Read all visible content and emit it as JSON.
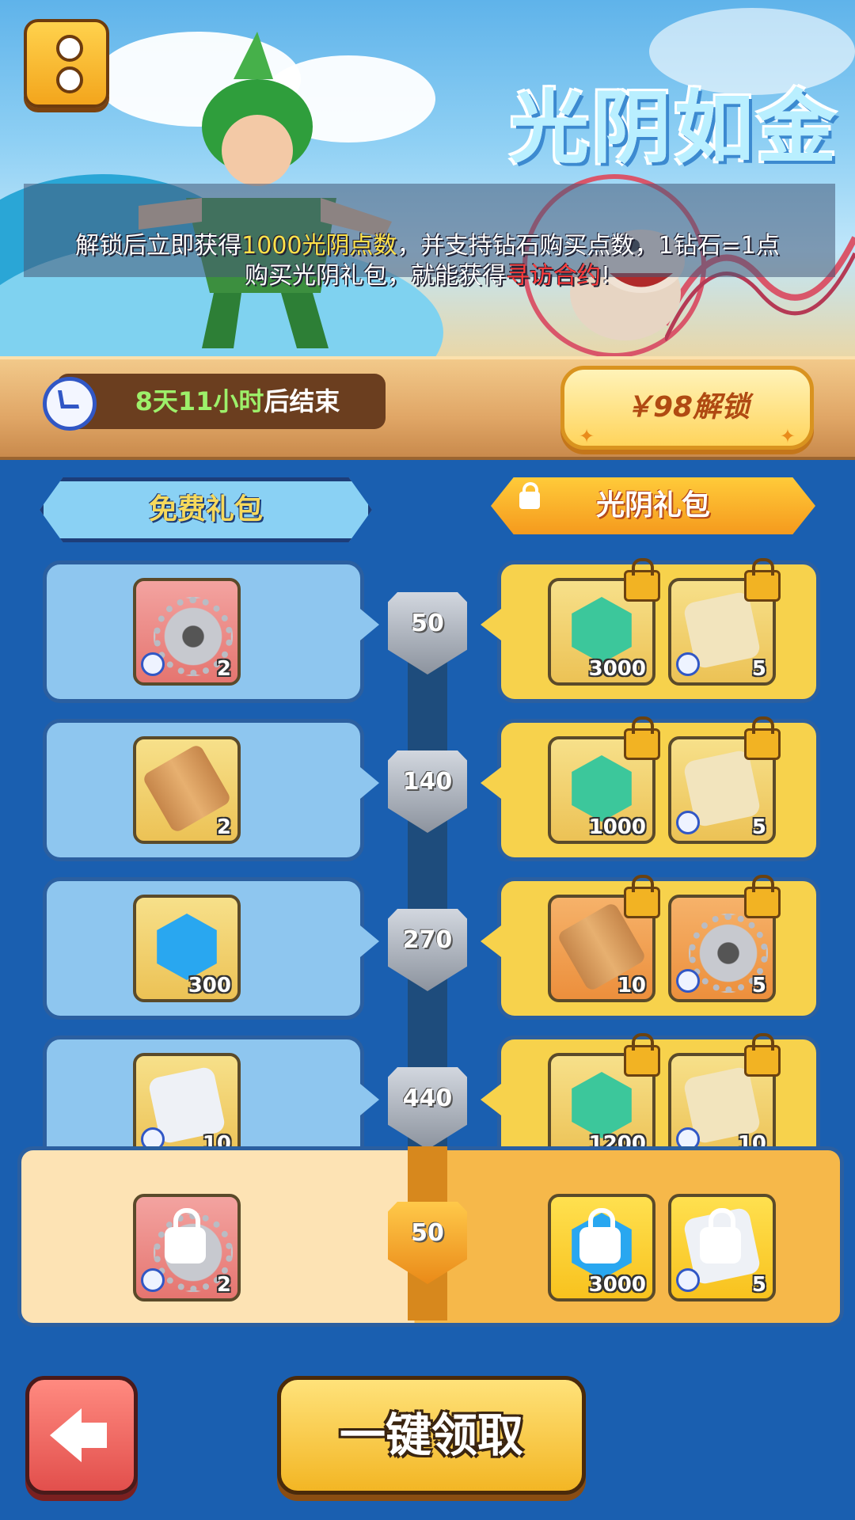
{
  "header": {
    "title": "光阴如金",
    "description_line1_parts": [
      "解锁后立即获得",
      "1000光阴点数",
      "，并支持钻石购买点数，1钻石=1点"
    ],
    "description_line2_parts": [
      "购买光阴礼包，就能获得",
      "寻访合约",
      "!"
    ]
  },
  "timer": {
    "highlight": "8天11小时",
    "suffix": "后结束"
  },
  "unlock": {
    "label": "￥98解锁"
  },
  "tracks": {
    "free_label": "免费礼包",
    "paid_label": "光阴礼包"
  },
  "rows": [
    {
      "level": "50",
      "free": {
        "icon": "gear-icon",
        "qty": "2",
        "timed": true
      },
      "paid": [
        {
          "icon": "green-gem-icon",
          "qty": "3000",
          "timed": false,
          "locked": true
        },
        {
          "icon": "dice-icon",
          "qty": "5",
          "timed": true,
          "locked": true
        }
      ]
    },
    {
      "level": "140",
      "free": {
        "icon": "scroll-icon",
        "qty": "2",
        "timed": false
      },
      "paid": [
        {
          "icon": "green-gem-icon",
          "qty": "1000",
          "timed": false,
          "locked": true
        },
        {
          "icon": "dice-icon",
          "qty": "5",
          "timed": true,
          "locked": true
        }
      ]
    },
    {
      "level": "270",
      "free": {
        "icon": "blue-gem-icon",
        "qty": "300",
        "timed": false
      },
      "paid": [
        {
          "icon": "scroll-icon",
          "qty": "10",
          "timed": false,
          "locked": true
        },
        {
          "icon": "gear-icon",
          "qty": "5",
          "timed": true,
          "locked": true
        }
      ]
    },
    {
      "level": "440",
      "free": {
        "icon": "white-dice-icon",
        "qty": "10",
        "timed": true
      },
      "paid": [
        {
          "icon": "green-gem-icon",
          "qty": "1200",
          "timed": false,
          "locked": true
        },
        {
          "icon": "dice-icon",
          "qty": "10",
          "timed": true,
          "locked": true
        }
      ]
    }
  ],
  "current_reward": {
    "level": "50",
    "free": {
      "icon": "gear-icon",
      "qty": "2",
      "timed": true,
      "locked": true
    },
    "paid": [
      {
        "icon": "blue-gem-icon",
        "qty": "3000",
        "timed": false,
        "locked": true
      },
      {
        "icon": "white-dice-icon",
        "qty": "5",
        "timed": true,
        "locked": true
      }
    ]
  },
  "footer": {
    "back_icon": "back-arrow-icon",
    "claim_all_label": "一键领取"
  },
  "colors": {
    "free_card": "#8ec6ef",
    "paid_card": "#f7d24c",
    "accent_orange": "#f59a1d",
    "highlight_yellow": "#ffe14a",
    "highlight_red": "#ff3b3b",
    "timer_green": "#9df06a"
  }
}
